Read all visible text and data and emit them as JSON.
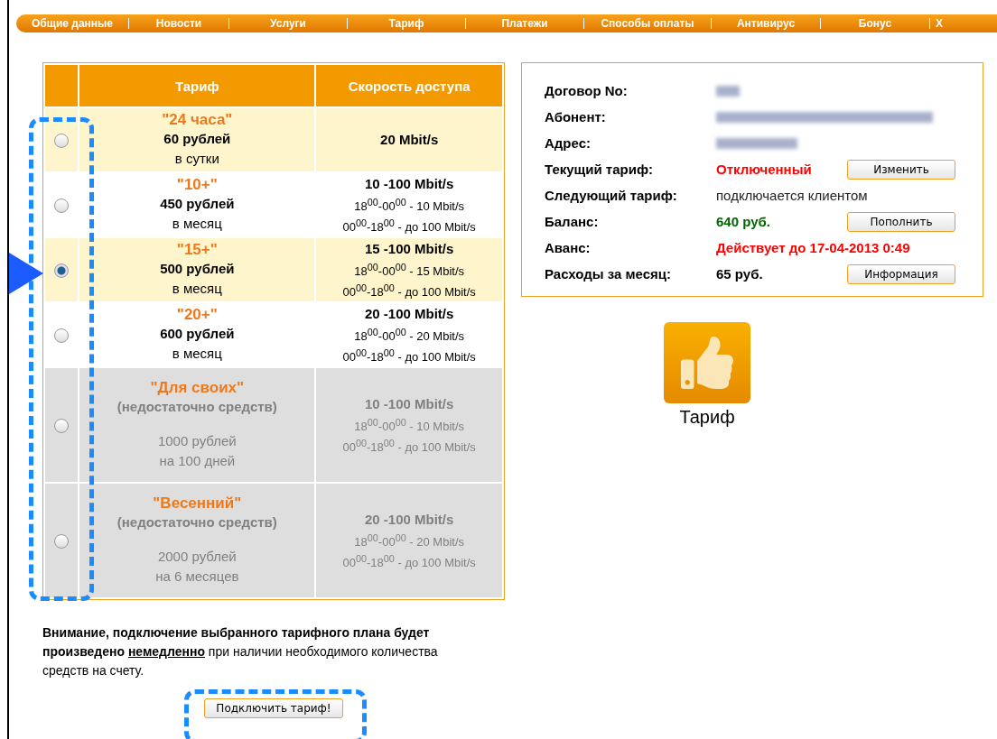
{
  "nav": [
    "Общие данные",
    "Новости",
    "Услуги",
    "Тариф",
    "Платежи",
    "Способы оплаты",
    "Антивирус",
    "Бонус",
    "X"
  ],
  "table": {
    "columns": [
      "Тариф",
      "Скорость доступа"
    ],
    "rows": [
      {
        "name": "\"24 часа\"",
        "price": "60 рублей",
        "period": "в сутки",
        "speed": "20 Mbit/s",
        "schedule": [],
        "selected": false,
        "disabled": false
      },
      {
        "name": "\"10+\"",
        "price": "450 рублей",
        "period": "в месяц",
        "speed": "10 -100 Mbit/s",
        "schedule": [
          "18$^{00}$-00$^{00}$ - 10 Mbit/s",
          "00$^{00}$-18$^{00}$ - до 100 Mbit/s"
        ],
        "selected": false,
        "disabled": false
      },
      {
        "name": "\"15+\"",
        "price": "500 рублей",
        "period": "в месяц",
        "speed": "15 -100 Mbit/s",
        "schedule": [
          "18$^{00}$-00$^{00}$ - 15 Mbit/s",
          "00$^{00}$-18$^{00}$ - до 100 Mbit/s"
        ],
        "selected": true,
        "disabled": false
      },
      {
        "name": "\"20+\"",
        "price": "600 рублей",
        "period": "в месяц",
        "speed": "20 -100 Mbit/s",
        "schedule": [
          "18$^{00}$-00$^{00}$ - 20 Mbit/s",
          "00$^{00}$-18$^{00}$ - до 100 Mbit/s"
        ],
        "selected": false,
        "disabled": false
      },
      {
        "name": "\"Для своих\"",
        "note": "(недостаточно средств)",
        "price": "1000 рублей",
        "period": "на 100 дней",
        "speed": "10 -100 Mbit/s",
        "schedule": [
          "18$^{00}$-00$^{00}$ - 10 Mbit/s",
          "00$^{00}$-18$^{00}$ - до 100 Mbit/s"
        ],
        "selected": false,
        "disabled": true
      },
      {
        "name": "\"Весенний\"",
        "note": "(недостаточно средств)",
        "price": "2000 рублей",
        "period": "на 6 месяцев",
        "speed": "20 -100 Mbit/s",
        "schedule": [
          "18$^{00}$-00$^{00}$ - 20 Mbit/s",
          "00$^{00}$-18$^{00}$ - до 100 Mbit/s"
        ],
        "selected": false,
        "disabled": true
      }
    ]
  },
  "notice": "**Внимание, подключение выбранного тарифного плана будет произведено** **немедленно** при наличии необходимого количества средств на счету.",
  "connect_button": "Подключить тариф!",
  "account": [
    {
      "label": "Договор No:",
      "kind": "blurred"
    },
    {
      "label": "Абонент:",
      "kind": "blurred"
    },
    {
      "label": "Адрес:",
      "kind": "blurred"
    },
    {
      "label": "Текущий тариф:",
      "kind": "text",
      "value": "Отключенный",
      "color": "#ff0000",
      "button": "Изменить"
    },
    {
      "label": "Следующий тариф:",
      "kind": "plain",
      "value": "подключается клиентом"
    },
    {
      "label": "Баланс:",
      "kind": "text",
      "value": "640 руб.",
      "color": "#006600",
      "button": "Пополнить"
    },
    {
      "label": "Аванс:",
      "kind": "text",
      "value": "Действует до 17-04-2013 0:49",
      "color": "#ff0000"
    },
    {
      "label": "Расходы за месяц:",
      "kind": "text",
      "value": "65 руб.",
      "color": "#000000",
      "button": "Информация"
    }
  ],
  "tile_label": "Тариф"
}
